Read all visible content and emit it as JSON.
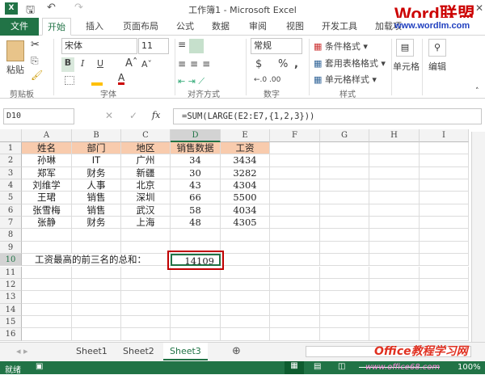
{
  "window": {
    "title": "工作簿1 - Microsoft Excel",
    "app_icon": "X"
  },
  "ribbon_tabs": [
    "文件",
    "开始",
    "插入",
    "页面布局",
    "公式",
    "数据",
    "审阅",
    "视图",
    "开发工具",
    "加载项"
  ],
  "ribbon": {
    "paste": "粘贴",
    "clipboard": "剪贴板",
    "font_name": "宋体",
    "font_size": "11",
    "bold": "B",
    "italic": "I",
    "underline": "U",
    "font_group": "字体",
    "align_group": "对齐方式",
    "number_format": "常规",
    "currency": "$",
    "percent": "%",
    "comma": ",",
    "number_group": "数字",
    "cond_format": "条件格式",
    "table_format": "套用表格格式",
    "cell_style": "单元格样式",
    "style_group": "样式",
    "cells": "单元格",
    "edit": "编辑"
  },
  "formula_bar": {
    "name_box": "D10",
    "fx": "fx",
    "formula": "=SUM(LARGE(E2:E7,{1,2,3}))"
  },
  "columns": [
    "A",
    "B",
    "C",
    "D",
    "E",
    "F",
    "G",
    "H",
    "I"
  ],
  "rows": [
    [
      "姓名",
      "部门",
      "地区",
      "销售数据",
      "工资"
    ],
    [
      "孙琳",
      "IT",
      "广州",
      "34",
      "3434"
    ],
    [
      "郑军",
      "财务",
      "新疆",
      "30",
      "3282"
    ],
    [
      "刘维学",
      "人事",
      "北京",
      "43",
      "4304"
    ],
    [
      "王珺",
      "销售",
      "深圳",
      "66",
      "5500"
    ],
    [
      "张雪梅",
      "销售",
      "武汉",
      "58",
      "4034"
    ],
    [
      "张静",
      "财务",
      "上海",
      "48",
      "4305"
    ],
    [],
    [],
    [
      "工资最高的前三名的总和：",
      "",
      "",
      "14109"
    ],
    [],
    [],
    [],
    [],
    [],
    []
  ],
  "sheets": [
    "Sheet1",
    "Sheet2",
    "Sheet3"
  ],
  "active_sheet": "Sheet3",
  "status": {
    "text": "就绪",
    "zoom": "100%"
  },
  "watermarks": {
    "top": "Word联盟",
    "top_url": "www.wordlm.com",
    "bottom": "Office教程学习网",
    "bottom_url": "www.office68.com"
  },
  "colors": {
    "accent": "#217346",
    "header_fill": "#f8cbad",
    "highlight": "#c00000"
  }
}
